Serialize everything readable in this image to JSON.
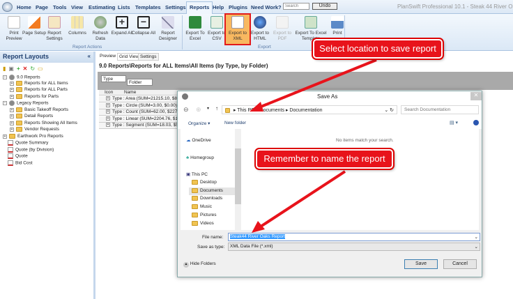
{
  "app": {
    "title": "PlanSwift Professional 10.1 - Steak 44 River O"
  },
  "tabs": [
    "Home",
    "Page",
    "Tools",
    "View",
    "Estimating",
    "Lists",
    "Templates",
    "Settings",
    "Reports",
    "Help",
    "Plugins",
    "Need Work?"
  ],
  "search": {
    "placeholder": "Search"
  },
  "undo_label": "Undo",
  "ribbon": {
    "actions": [
      "Print Preview",
      "Page Setup",
      "Report Settings",
      "Columns",
      "Refresh Data",
      "Expand All",
      "Collapse All",
      "Report Designer"
    ],
    "export": [
      "Export To Excel",
      "Export to CSV",
      "Export to XML",
      "Export to HTML",
      "Export to PDF",
      "Export To Excel Template",
      "Print"
    ],
    "group_actions": "Report Actions",
    "group_export": "Export"
  },
  "left": {
    "title": "Report Layouts",
    "collapse": "«",
    "tree": [
      "9.0 Reports",
      "Reports for ALL Items",
      "Reports for ALL Parts",
      "Reports for Parts",
      "Legacy Reports",
      "Basic Takeoff Reports",
      "Detail Reports",
      "Reports Showing All Items",
      "Vendor Requests",
      "Earthwork Pro Reports",
      "Quote Summary",
      "Quote (by Division)",
      "Quote",
      "Bid Cost"
    ]
  },
  "right": {
    "tabs": [
      "Preview",
      "Grid View",
      "Settings"
    ],
    "path": "9.0 Reports\\Reports for ALL Items\\All Items (by Type, by Folder)",
    "group_chips": [
      "Type",
      "Folder"
    ],
    "columns": [
      "Icon",
      "Name"
    ],
    "rows": [
      "Type : Area (SUM=21215.10, $83,",
      "Type : Circle (SUM=3.00, $0.00)",
      "Type : Count (SUM=62.00, $227.0",
      "Type : Linear (SUM=2204.76, $15,",
      "Type : Segment (SUM=18.03, $53"
    ]
  },
  "dialog": {
    "title": "Save As",
    "close": "✕",
    "breadcrumb": [
      "This PC",
      "Documents",
      "Documentation"
    ],
    "search_placeholder": "Search Documentation",
    "organize": "Organize ▾",
    "new_folder": "New folder",
    "empty": "No items match your search.",
    "nav": [
      "OneDrive",
      "Homegroup",
      "This PC",
      "Desktop",
      "Documents",
      "Downloads",
      "Music",
      "Pictures",
      "Videos"
    ],
    "file_name_label": "File name:",
    "file_name": "Steak44 River Oaks Report",
    "type_label": "Save as type:",
    "type": "XML Data File (*.xml)",
    "hide_folders": "Hide Folders",
    "save": "Save",
    "cancel": "Cancel"
  },
  "callouts": {
    "location": "Select location to save report",
    "name": "Remember to name the report"
  },
  "colors": {
    "callout": "#e8131b",
    "ribbon": "#dbe8f6",
    "highlight": "#3399ff"
  }
}
